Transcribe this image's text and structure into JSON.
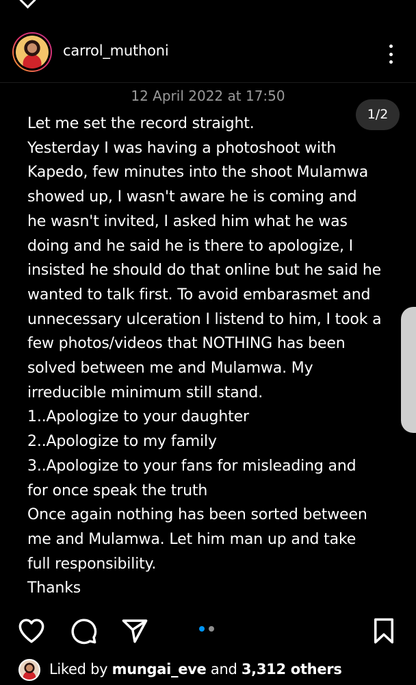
{
  "header": {
    "username": "carrol_muthoni"
  },
  "post": {
    "date": "12 April 2022 at 17:50",
    "page_counter": "1/2",
    "lines": [
      "Let me set the record straight.",
      "Yesterday I was having a photoshoot with",
      "Kapedo, few minutes into the shoot Mulamwa",
      "showed up, I wasn't aware he is coming and",
      "he wasn't invited, I asked him what he was",
      "doing and he said he is there to apologize, I",
      "insisted he should do that online but he said he",
      "wanted to talk first. To avoid embarasmet and",
      "unnecessary ulceration I listend to him, I took a",
      "few photos/videos that NOTHING has been",
      "solved between me and Mulamwa. My",
      "irreducible minimum still stand.",
      "1..Apologize to your daughter",
      "2..Apologize to my family",
      "3..Apologize to your fans for misleading and",
      "for once speak the truth",
      "Once again nothing has been sorted between",
      "me and Mulamwa. Let him man up and take",
      "full responsibility.",
      "Thanks"
    ]
  },
  "carousel": {
    "active_color": "#0095f6",
    "inactive_color": "#8e8e8e"
  },
  "actions": {
    "icons": [
      "heart-icon",
      "comment-icon",
      "share-icon",
      "bookmark-icon"
    ]
  },
  "likes": {
    "liked_by_prefix": "Liked by",
    "liker_username": "mungai_eve",
    "and_text": "and",
    "others_count": "3,312 others"
  }
}
